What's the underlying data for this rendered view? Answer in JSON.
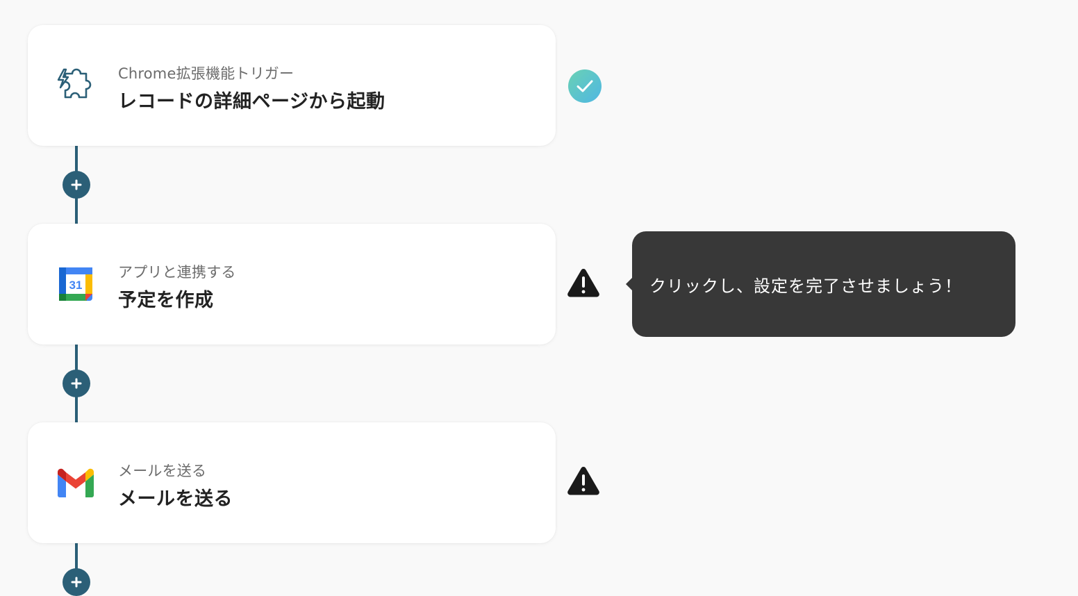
{
  "flow": {
    "steps": [
      {
        "subtitle": "Chrome拡張機能トリガー",
        "title": "レコードの詳細ページから起動",
        "icon": "chrome-extension-puzzle-icon",
        "status": "complete"
      },
      {
        "subtitle": "アプリと連携する",
        "title": "予定を作成",
        "icon": "google-calendar-icon",
        "icon_text": "31",
        "status": "warning"
      },
      {
        "subtitle": "メールを送る",
        "title": "メールを送る",
        "icon": "gmail-icon",
        "status": "warning"
      }
    ],
    "add_button_icon": "plus-icon",
    "tooltip": {
      "text": "クリックし、設定を完了させましょう！"
    }
  },
  "colors": {
    "background": "#f9f9f9",
    "connector": "#2b5f77",
    "check_gradient_start": "#6ad1b4",
    "check_gradient_end": "#4fb7e3",
    "warning": "#1a1a1a",
    "tooltip_bg": "#383838"
  }
}
